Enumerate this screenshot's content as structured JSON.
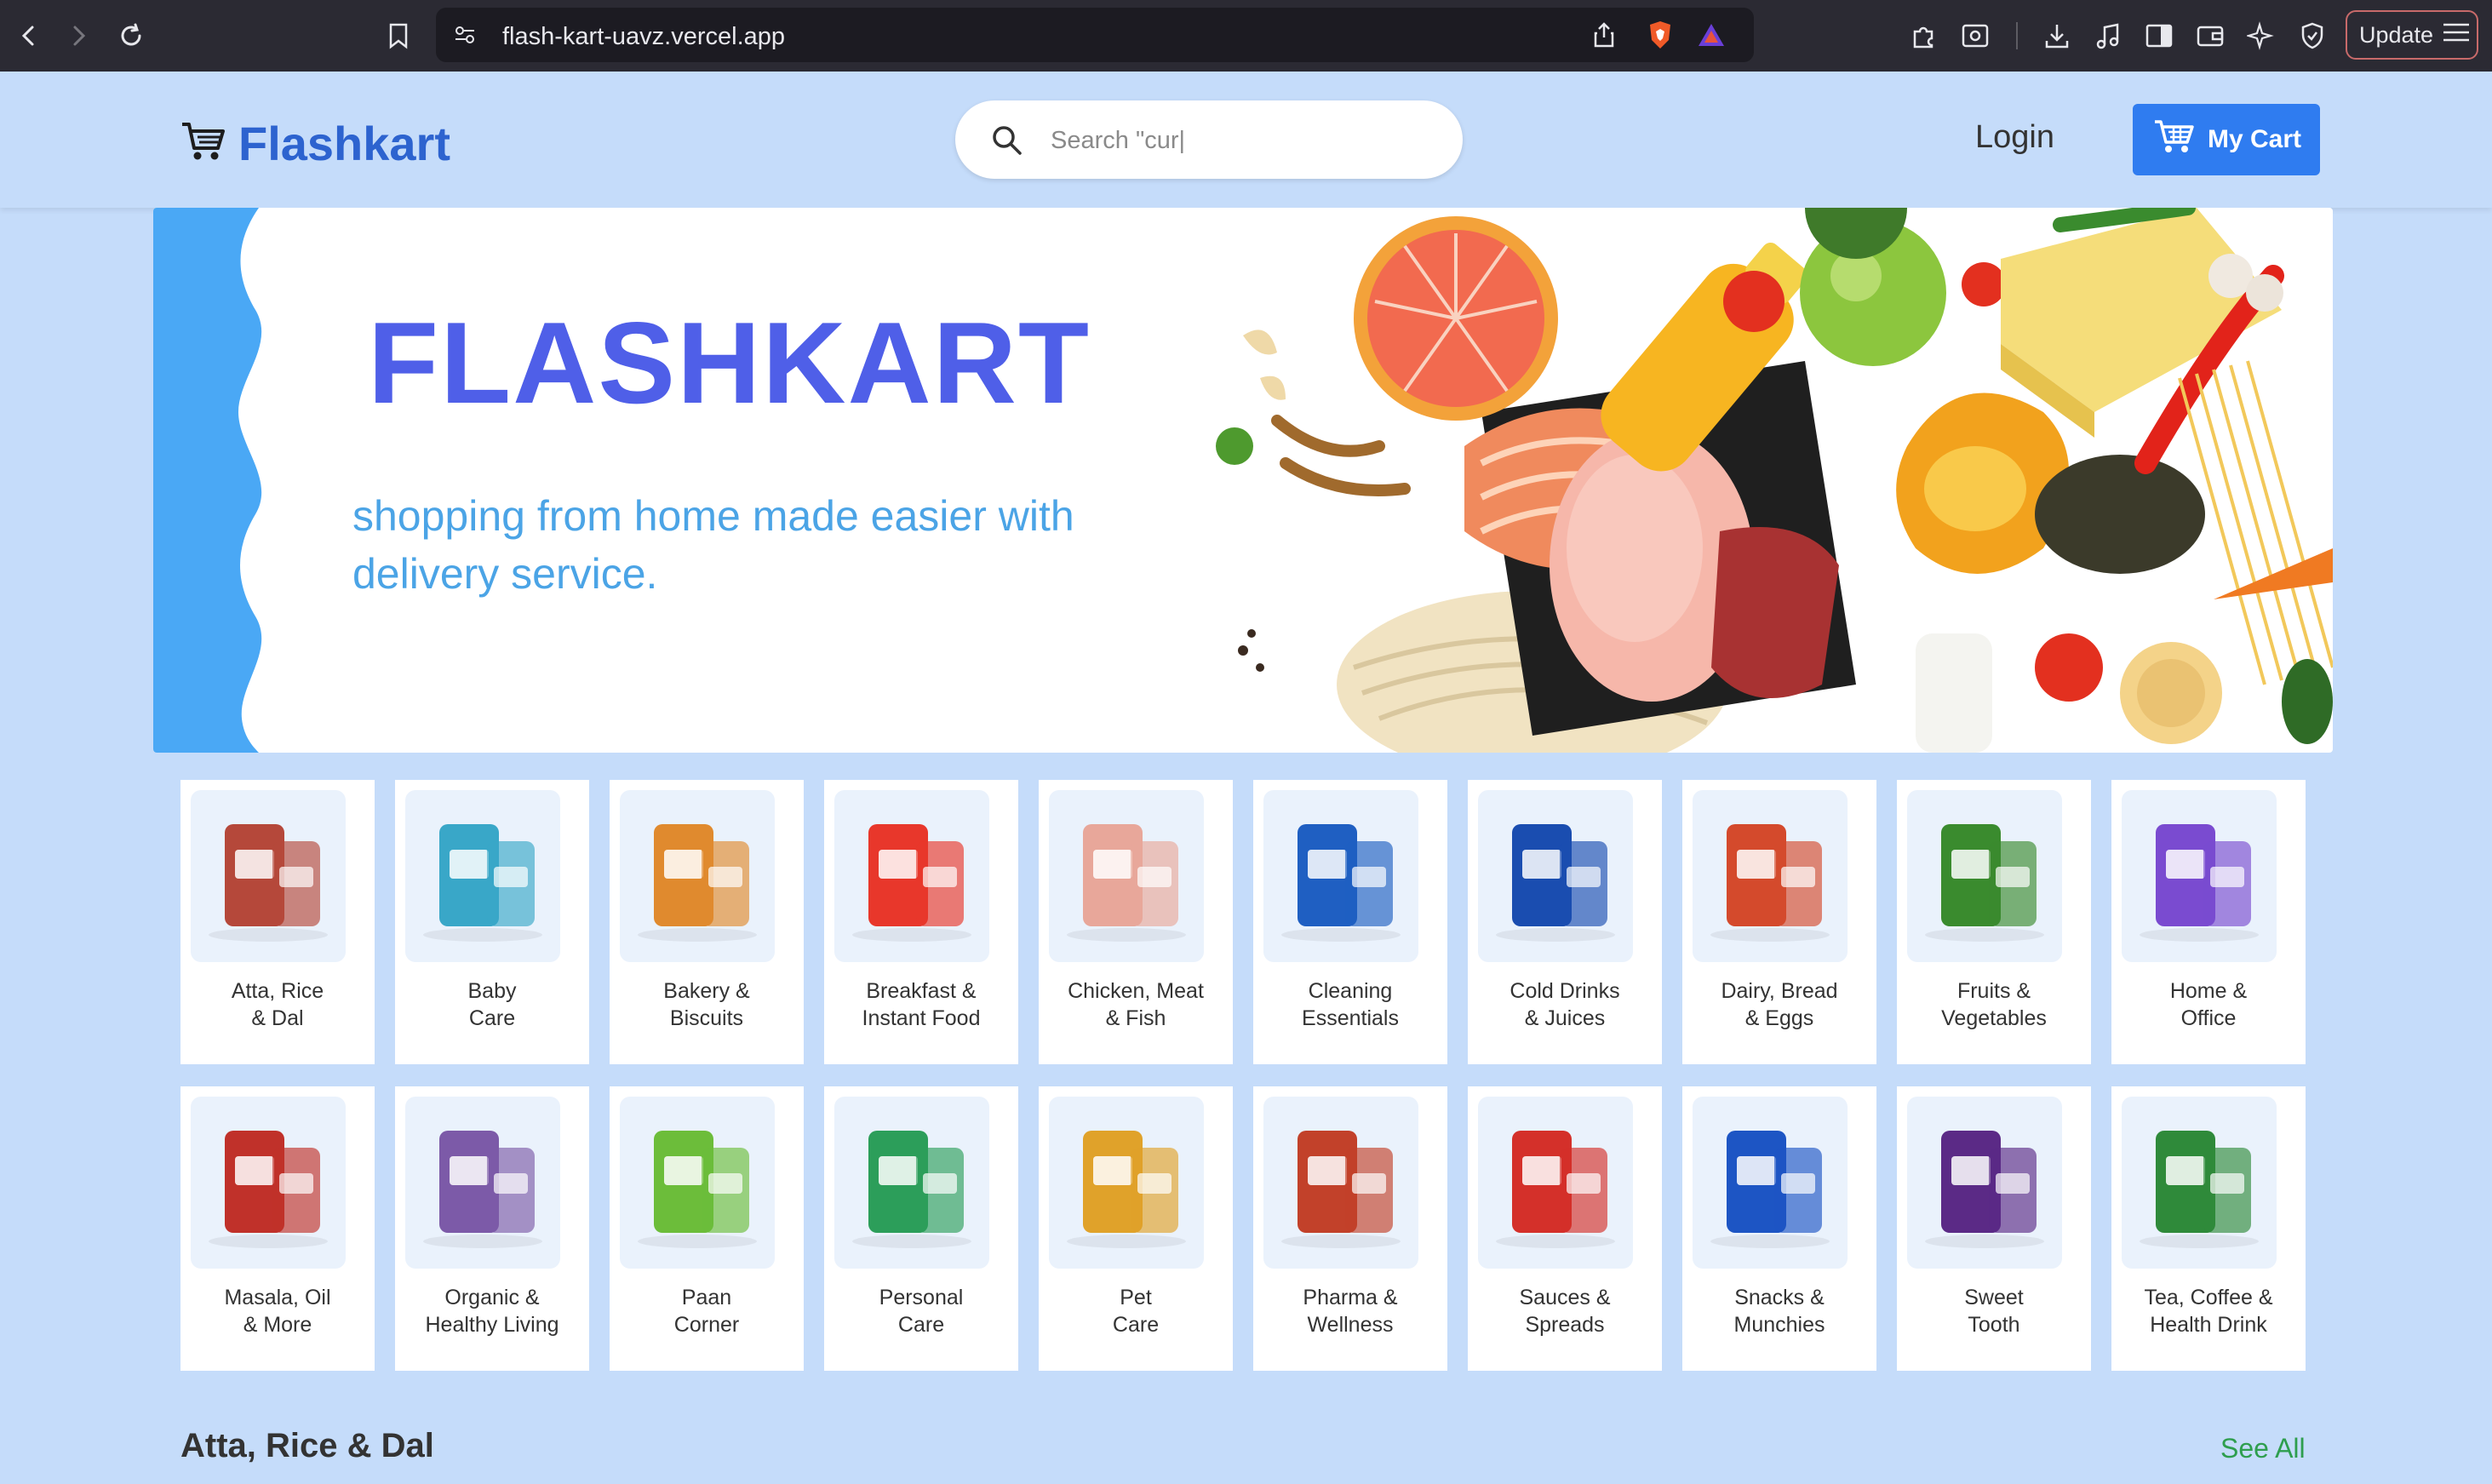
{
  "browser": {
    "url": "flash-kart-uavz.vercel.app",
    "update_label": "Update"
  },
  "header": {
    "brand": "Flashkart",
    "search_placeholder": "Search \"cur|",
    "login_label": "Login",
    "cart_label": "My Cart"
  },
  "banner": {
    "title": "FLASHKART",
    "subtitle": "shopping from home made easier with delivery service."
  },
  "categories": [
    {
      "label": "Atta, Rice\n& Dal",
      "color": "#b5483a",
      "icon": "grain-bag-icon"
    },
    {
      "label": "Baby\nCare",
      "color": "#39a7c8",
      "icon": "diaper-pack-icon"
    },
    {
      "label": "Bakery &\nBiscuits",
      "color": "#e08a2e",
      "icon": "biscuit-pack-icon"
    },
    {
      "label": "Breakfast &\nInstant Food",
      "color": "#e8372b",
      "icon": "cereal-box-icon"
    },
    {
      "label": "Chicken, Meat\n& Fish",
      "color": "#e8a79a",
      "icon": "raw-chicken-icon"
    },
    {
      "label": "Cleaning\nEssentials",
      "color": "#1f5fc2",
      "icon": "detergent-pack-icon"
    },
    {
      "label": "Cold Drinks\n& Juices",
      "color": "#1a4db0",
      "icon": "soda-bottle-icon"
    },
    {
      "label": "Dairy, Bread\n& Eggs",
      "color": "#d44a2c",
      "icon": "bread-pack-icon"
    },
    {
      "label": "Fruits &\nVegetables",
      "color": "#3a8b2e",
      "icon": "banana-spinach-icon"
    },
    {
      "label": "Home &\nOffice",
      "color": "#7a4bd0",
      "icon": "spray-can-icon"
    },
    {
      "label": "Masala, Oil\n& More",
      "color": "#c0312a",
      "icon": "masala-pack-icon"
    },
    {
      "label": "Organic &\nHealthy Living",
      "color": "#7c5aa8",
      "icon": "organic-pouch-icon"
    },
    {
      "label": "Paan\nCorner",
      "color": "#6cbd3a",
      "icon": "lighter-icon"
    },
    {
      "label": "Personal\nCare",
      "color": "#2c9e5a",
      "icon": "handwash-bottle-icon"
    },
    {
      "label": "Pet\nCare",
      "color": "#e0a22a",
      "icon": "pet-food-icon"
    },
    {
      "label": "Pharma &\nWellness",
      "color": "#c2412a",
      "icon": "medicine-bottle-icon"
    },
    {
      "label": "Sauces &\nSpreads",
      "color": "#d4302a",
      "icon": "ketchup-pouch-icon"
    },
    {
      "label": "Snacks &\nMunchies",
      "color": "#1d55c4",
      "icon": "chips-pack-icon"
    },
    {
      "label": "Sweet\nTooth",
      "color": "#5b2a86",
      "icon": "chocolate-bar-icon"
    },
    {
      "label": "Tea, Coffee &\nHealth Drink",
      "color": "#2f8a3a",
      "icon": "tea-pack-icon"
    }
  ],
  "section": {
    "title": "Atta, Rice & Dal",
    "see_all": "See All"
  }
}
